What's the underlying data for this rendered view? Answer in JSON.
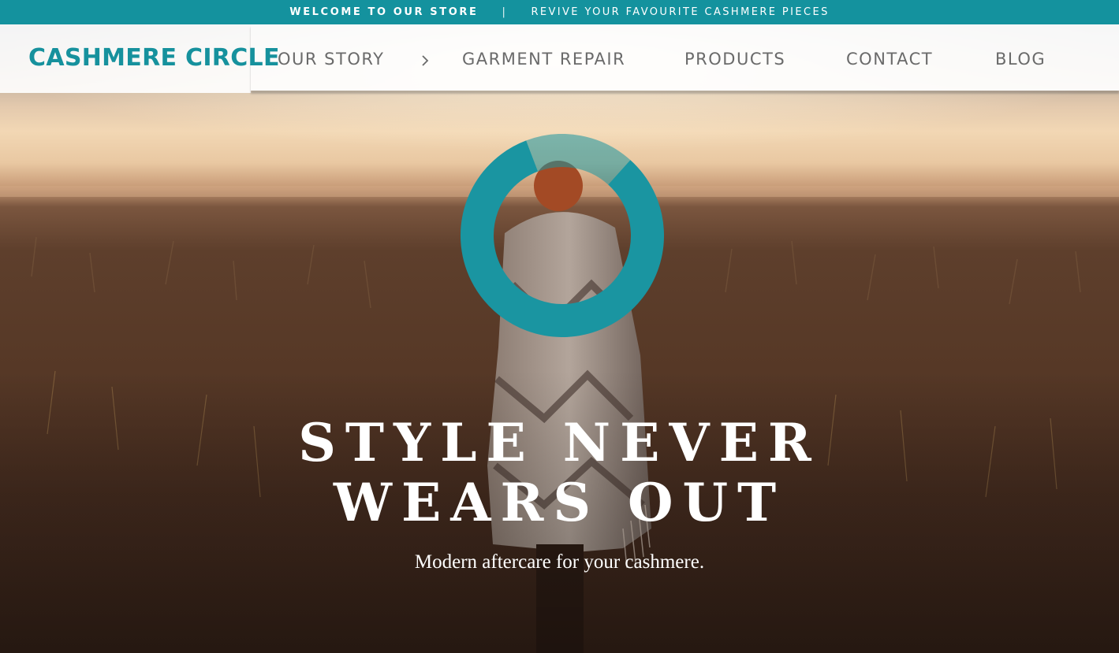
{
  "announcement": {
    "welcome": "WELCOME TO OUR STORE",
    "divider": "|",
    "promo": "REVIVE YOUR FAVOURITE CASHMERE PIECES"
  },
  "brand": {
    "logo": "CASHMERE CIRCLE",
    "color": "#16919d"
  },
  "nav": {
    "items": [
      {
        "label": "OUR STORY",
        "icon": "chevron-right-icon"
      },
      {
        "label": "GARMENT REPAIR"
      },
      {
        "label": "PRODUCTS"
      },
      {
        "label": "CONTACT"
      },
      {
        "label": "BLOG"
      }
    ]
  },
  "hero": {
    "headline_line1": "STYLE NEVER",
    "headline_line2": "WEARS OUT",
    "tagline": "Modern aftercare for your cashmere.",
    "ring_icon": "circle-logo-ring",
    "ring_color": "#1a95a1"
  }
}
